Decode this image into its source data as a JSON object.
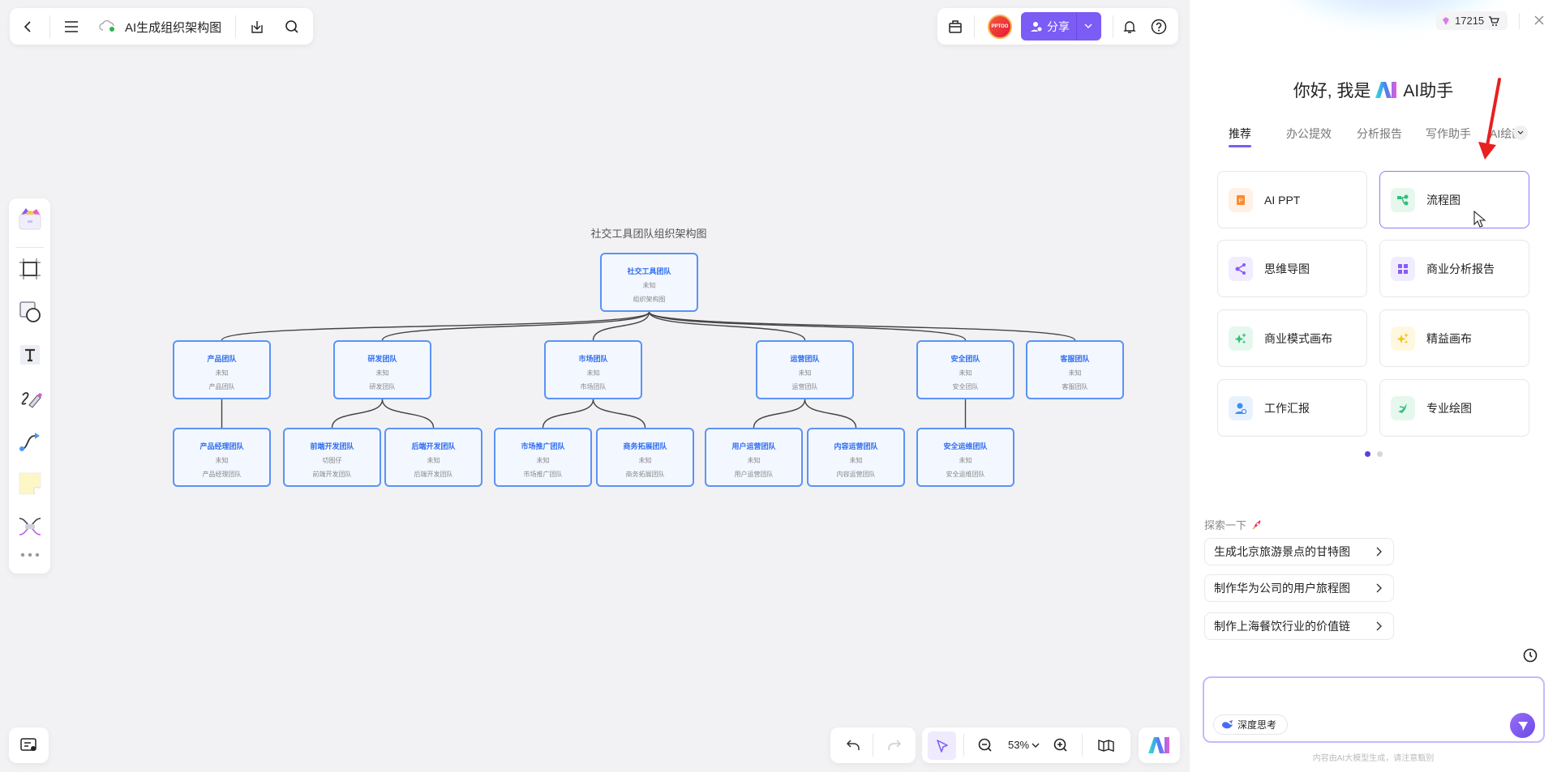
{
  "topbar": {
    "doc_title": "AI生成组织架构图",
    "share_label": "分享"
  },
  "org": {
    "title": "社交工具团队组织架构图",
    "root": {
      "name": "社交工具团队",
      "role": "未知",
      "desc": "组织架构图",
      "children": [
        {
          "name": "产品团队",
          "role": "未知",
          "desc": "产品团队",
          "children": [
            {
              "name": "产品经理团队",
              "role": "未知",
              "desc": "产品经理团队"
            }
          ]
        },
        {
          "name": "研发团队",
          "role": "未知",
          "desc": "研发团队",
          "children": [
            {
              "name": "前端开发团队",
              "role": "切图仔",
              "desc": "前端开发团队"
            },
            {
              "name": "后端开发团队",
              "role": "未知",
              "desc": "后端开发团队"
            }
          ]
        },
        {
          "name": "市场团队",
          "role": "未知",
          "desc": "市场团队",
          "children": [
            {
              "name": "市场推广团队",
              "role": "未知",
              "desc": "市场推广团队"
            },
            {
              "name": "商务拓展团队",
              "role": "未知",
              "desc": "商务拓展团队"
            }
          ]
        },
        {
          "name": "运营团队",
          "role": "未知",
          "desc": "运营团队",
          "children": [
            {
              "name": "用户运营团队",
              "role": "未知",
              "desc": "用户运营团队"
            },
            {
              "name": "内容运营团队",
              "role": "未知",
              "desc": "内容运营团队"
            }
          ]
        },
        {
          "name": "安全团队",
          "role": "未知",
          "desc": "安全团队",
          "children": [
            {
              "name": "安全运维团队",
              "role": "未知",
              "desc": "安全运维团队"
            }
          ]
        },
        {
          "name": "客服团队",
          "role": "未知",
          "desc": "客服团队",
          "children": []
        }
      ]
    }
  },
  "zoom": {
    "level": "53%"
  },
  "panel": {
    "credits": "17215",
    "greeting_pre": "你好, 我是",
    "greeting_post": "AI助手",
    "tabs": [
      {
        "label": "推荐",
        "active": true
      },
      {
        "label": "办公提效"
      },
      {
        "label": "分析报告"
      },
      {
        "label": "写作助手"
      },
      {
        "label": "AI绘画"
      }
    ],
    "cards": [
      {
        "label": "AI PPT",
        "icon": "ppt-icon",
        "color": "#fb8c2f",
        "bg": "#fff1e6"
      },
      {
        "label": "流程图",
        "icon": "flowchart-icon",
        "color": "#2cc27a",
        "bg": "#e6f8ee",
        "selected": true
      },
      {
        "label": "思维导图",
        "icon": "mindmap-icon",
        "color": "#8a5cf5",
        "bg": "#f1ecff"
      },
      {
        "label": "商业分析报告",
        "icon": "grid-icon",
        "color": "#8a5cf5",
        "bg": "#f1ecff"
      },
      {
        "label": "商业模式画布",
        "icon": "sparkle-icon",
        "color": "#2cc27a",
        "bg": "#e6f8ee"
      },
      {
        "label": "精益画布",
        "icon": "sparkle-icon",
        "color": "#f5c518",
        "bg": "#fff8e0"
      },
      {
        "label": "工作汇报",
        "icon": "user-search-icon",
        "color": "#3d8ef5",
        "bg": "#e8f2ff"
      },
      {
        "label": "专业绘图",
        "icon": "plane-icon",
        "color": "#2cc27a",
        "bg": "#e6f8ee"
      }
    ],
    "explore_label": "探索一下",
    "suggestions": [
      "生成北京旅游景点的甘特图",
      "制作华为公司的用户旅程图",
      "制作上海餐饮行业的价值链"
    ],
    "deep_think_label": "深度思考",
    "input_placeholder": "",
    "disclaimer": "内容由AI大模型生成，请注意甄别",
    "accent": "#7b5cf5"
  }
}
